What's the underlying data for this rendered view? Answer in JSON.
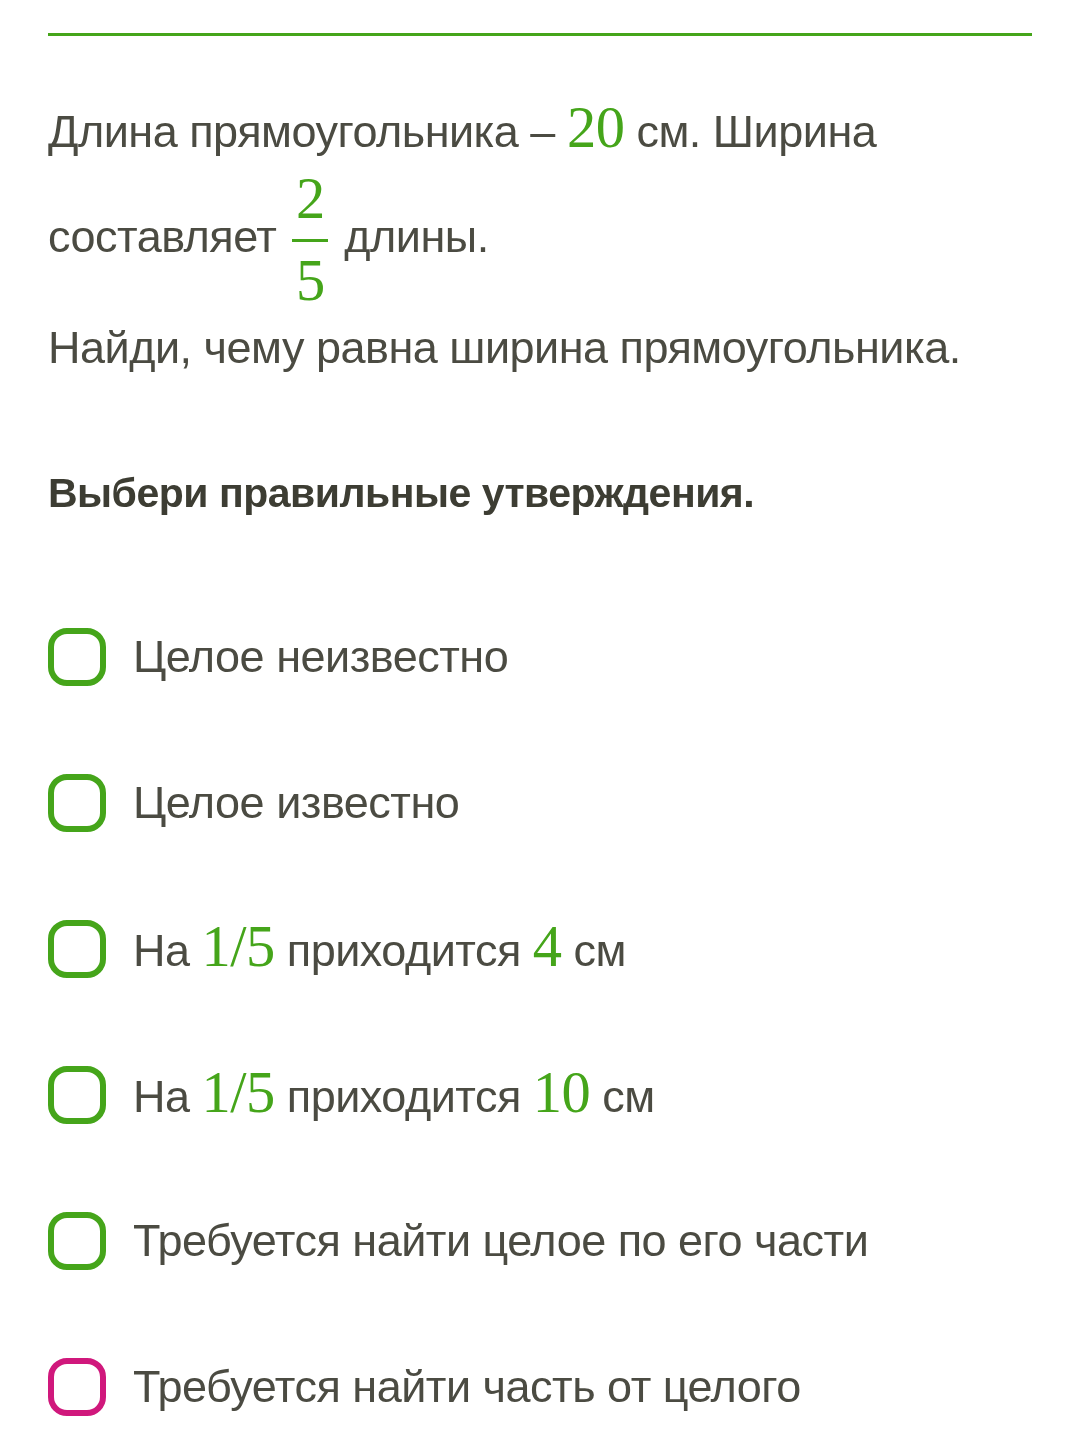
{
  "problem": {
    "paragraphs": [
      [
        {
          "kind": "text",
          "text": "Длина прямоугольника –"
        },
        {
          "kind": "math",
          "text": "20"
        },
        {
          "kind": "text",
          "text": "см. Ширина составляет"
        },
        {
          "kind": "fraction",
          "numerator": "2",
          "denominator": "5"
        },
        {
          "kind": "text",
          "text": "длины."
        }
      ],
      [
        {
          "kind": "text",
          "text": "Найди, чему равна ширина прямоугольника."
        }
      ]
    ]
  },
  "instruction": "Выбери правильные утверждения.",
  "options": [
    {
      "checked": false,
      "color": "#45a51a",
      "segments": [
        {
          "kind": "text",
          "text": "Целое неизвестно"
        }
      ]
    },
    {
      "checked": false,
      "color": "#45a51a",
      "segments": [
        {
          "kind": "text",
          "text": "Целое известно"
        }
      ]
    },
    {
      "checked": false,
      "color": "#45a51a",
      "segments": [
        {
          "kind": "text",
          "text": "На"
        },
        {
          "kind": "math",
          "text": "1/5"
        },
        {
          "kind": "text",
          "text": "приходится"
        },
        {
          "kind": "math",
          "text": "4"
        },
        {
          "kind": "text",
          "text": "см"
        }
      ]
    },
    {
      "checked": false,
      "color": "#45a51a",
      "segments": [
        {
          "kind": "text",
          "text": "На"
        },
        {
          "kind": "math",
          "text": "1/5"
        },
        {
          "kind": "text",
          "text": "приходится"
        },
        {
          "kind": "math",
          "text": "10"
        },
        {
          "kind": "text",
          "text": "см"
        }
      ]
    },
    {
      "checked": false,
      "color": "#45a51a",
      "segments": [
        {
          "kind": "text",
          "text": "Требуется найти целое по его части"
        }
      ]
    },
    {
      "checked": false,
      "color": "#d0187c",
      "segments": [
        {
          "kind": "text",
          "text": "Требуется найти часть от целого"
        }
      ]
    }
  ]
}
